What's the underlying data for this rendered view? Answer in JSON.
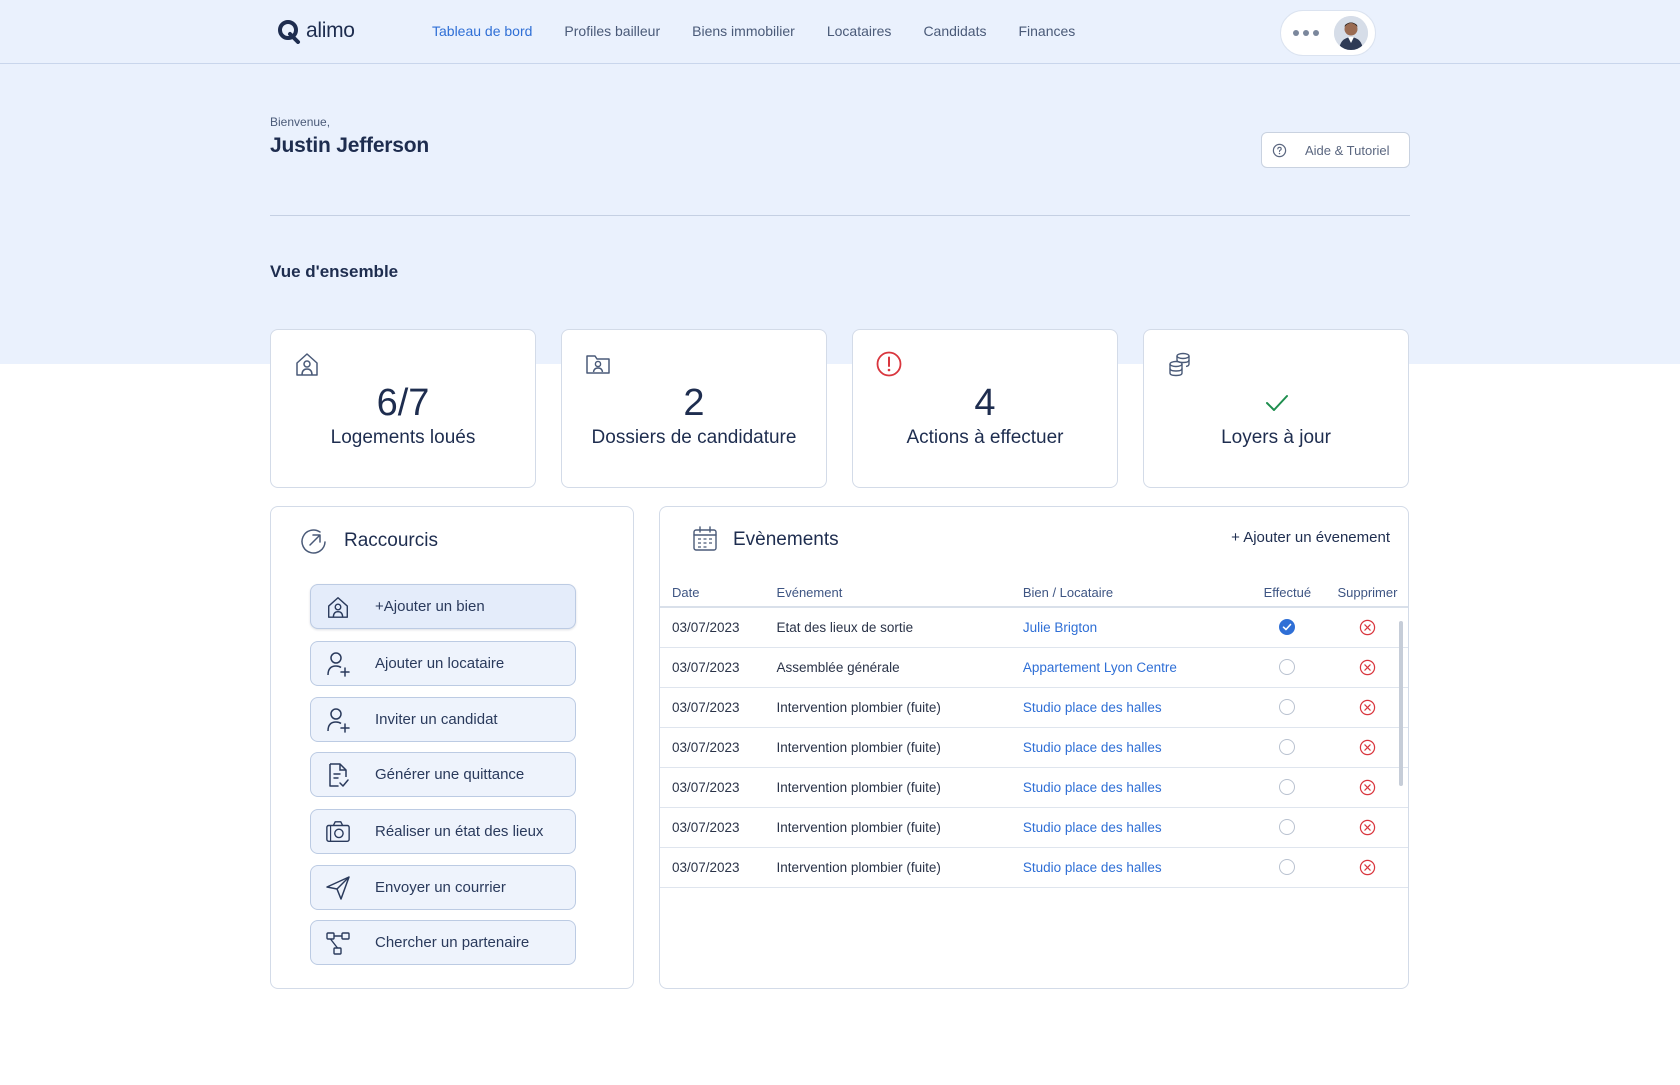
{
  "app": {
    "logo_text": "alimo"
  },
  "nav": {
    "items": [
      {
        "label": "Tableau de bord",
        "active": true
      },
      {
        "label": "Profiles bailleur",
        "active": false
      },
      {
        "label": "Biens immobilier",
        "active": false
      },
      {
        "label": "Locataires",
        "active": false
      },
      {
        "label": "Candidats",
        "active": false
      },
      {
        "label": "Finances",
        "active": false
      }
    ]
  },
  "header": {
    "welcome": "Bienvenue,",
    "user_name": "Justin Jefferson",
    "help_label": "Aide & Tutoriel"
  },
  "overview": {
    "title": "Vue d'ensemble",
    "cards": [
      {
        "icon": "house-user-icon",
        "value": "6/7",
        "label": "Logements loués"
      },
      {
        "icon": "folder-user-icon",
        "value": "2",
        "label": "Dossiers de candidature"
      },
      {
        "icon": "alert-circle-icon",
        "value": "4",
        "label": "Actions à effectuer"
      },
      {
        "icon": "coins-icon",
        "value": "",
        "label": "Loyers à jour"
      }
    ]
  },
  "shortcuts": {
    "title": "Raccourcis",
    "items": [
      {
        "icon": "house-user-icon",
        "label": "+Ajouter un bien"
      },
      {
        "icon": "user-plus-icon",
        "label": "Ajouter un locataire"
      },
      {
        "icon": "user-plus-icon",
        "label": "Inviter un candidat"
      },
      {
        "icon": "document-check-icon",
        "label": "Générer une quittance"
      },
      {
        "icon": "camera-icon",
        "label": "Réaliser un état des lieux"
      },
      {
        "icon": "send-icon",
        "label": "Envoyer un courrier"
      },
      {
        "icon": "network-icon",
        "label": "Chercher un partenaire"
      }
    ]
  },
  "events": {
    "title": "Evènements",
    "add_label": "+  Ajouter un évenement",
    "columns": [
      "Date",
      "Evénement",
      "Bien / Locataire",
      "Effectué",
      "Supprimer"
    ],
    "rows": [
      {
        "date": "03/07/2023",
        "event": "Etat des lieux de sortie",
        "target": "Julie Brigton",
        "done": true
      },
      {
        "date": "03/07/2023",
        "event": "Assemblée générale",
        "target": "Appartement Lyon Centre",
        "done": false
      },
      {
        "date": "03/07/2023",
        "event": "Intervention plombier (fuite)",
        "target": "Studio place des halles",
        "done": false
      },
      {
        "date": "03/07/2023",
        "event": "Intervention plombier (fuite)",
        "target": "Studio place des halles",
        "done": false
      },
      {
        "date": "03/07/2023",
        "event": "Intervention plombier (fuite)",
        "target": "Studio place des halles",
        "done": false
      },
      {
        "date": "03/07/2023",
        "event": "Intervention plombier (fuite)",
        "target": "Studio place des halles",
        "done": false
      },
      {
        "date": "03/07/2023",
        "event": "Intervention plombier (fuite)",
        "target": "Studio place des halles",
        "done": false
      }
    ]
  },
  "colors": {
    "primary": "#2f6fd6",
    "text": "#1e2d4f",
    "hero_bg": "#eaf1fd",
    "alert": "#d9363e",
    "success": "#1e8e4e"
  }
}
